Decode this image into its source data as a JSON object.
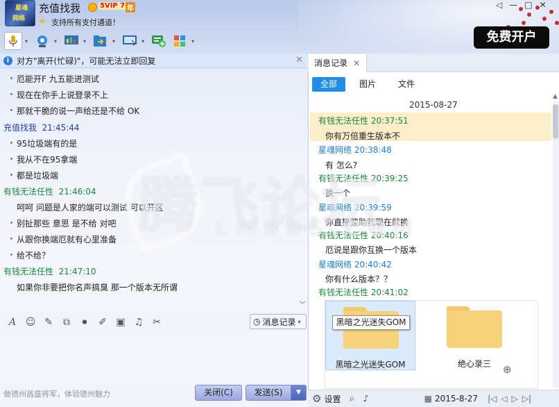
{
  "header": {
    "title": "充值找我",
    "vip_label": "5VIP 7",
    "vip_year": "年",
    "signature": "支持所有支付通道！",
    "promo_button": "免费开户",
    "window_controls": [
      "◁",
      "—",
      "□",
      "✕"
    ]
  },
  "avatar_text": [
    "星魂",
    "网络"
  ],
  "toolbar": {
    "icons": [
      "microphone-icon",
      "video-icon",
      "screen-share-icon",
      "file-transfer-icon",
      "remote-desktop-icon",
      "add-chat-icon",
      "apps-icon"
    ]
  },
  "notice": {
    "text": "对方\"离开(忙碌)\"，可能无法立即回复",
    "close": "✕"
  },
  "chat": [
    {
      "type": "line",
      "text": "厄能开F 九五能进测试"
    },
    {
      "type": "line",
      "text": "现在在你手上说登录不上"
    },
    {
      "type": "line",
      "text": "那就干脆的说一声给还是不给  OK"
    },
    {
      "type": "sender",
      "name": "充值找我",
      "time": "21:45:44",
      "color": "#1d3fb5"
    },
    {
      "type": "line",
      "text": "95垃圾端有的是"
    },
    {
      "type": "line",
      "text": "我从不在95拿端"
    },
    {
      "type": "line",
      "text": "都是垃圾端"
    },
    {
      "type": "sender",
      "name": "有钱无法任性",
      "time": "21:46:04",
      "color": "#18883a"
    },
    {
      "type": "plain",
      "text": "呵呵 问题是人家的端可以测试 可以开区"
    },
    {
      "type": "line",
      "text": "别扯那些 意思 是不给 对吧"
    },
    {
      "type": "line",
      "text": "从跟你换端厄就有心里准备"
    },
    {
      "type": "line",
      "text": "给不给？"
    },
    {
      "type": "sender",
      "name": "有钱无法任性",
      "time": "21:47:10",
      "color": "#18883a"
    },
    {
      "type": "plain",
      "text": "如果你非要把你名声搞臭 那一个版本无所谓"
    }
  ],
  "input_toolbar": {
    "icons": [
      "font-icon",
      "emoji-icon",
      "magic-icon",
      "screenshot-icon",
      "voice-icon",
      "edit-icon",
      "image-icon",
      "music-icon",
      "scissors-icon"
    ],
    "history_button": "消息记录"
  },
  "input": {
    "placeholder": "做德州昌盛将军，体验德州魅力",
    "close_button": "关闭(C)",
    "send_button": "发送(S)"
  },
  "history": {
    "tab_label": "消息记录",
    "filters": [
      "全部",
      "图片",
      "文件"
    ],
    "active_filter": "全部",
    "date": "2015-08-27",
    "messages": [
      {
        "sender": "有钱无法任性",
        "time": "20:37:51",
        "color": "#18883a",
        "text": "你有万倍重生版本不",
        "highlight": true
      },
      {
        "sender": "星魂网络",
        "time": "20:38:48",
        "color": "#1f7fd6",
        "text": "有 怎么?"
      },
      {
        "sender": "有钱无法任性",
        "time": "20:39:25",
        "color": "#18883a",
        "text": "换一个"
      },
      {
        "sender": "星魂网络",
        "time": "20:39:59",
        "color": "#1f7fd6",
        "text": "你直接整助我现在就换"
      },
      {
        "sender": "有钱无法任性",
        "time": "20:40:16",
        "color": "#18883a",
        "text": "厄说是跟你互换一个版本"
      },
      {
        "sender": "星魂网络",
        "time": "20:40:42",
        "color": "#1f7fd6",
        "text": "你有什么版本？？"
      },
      {
        "sender": "有钱无法任性",
        "time": "20:41:02",
        "color": "#18883a",
        "text": ""
      }
    ],
    "files": [
      "黑暗之光迷失GOM",
      "绝心录三"
    ],
    "tooltip": "黑暗之光迷失GOM",
    "bottom": {
      "settings": "设置",
      "date": "2015-8-27"
    }
  },
  "watermark": {
    "main": "腾飞论坛",
    "sub": "LMBBS.COM"
  }
}
